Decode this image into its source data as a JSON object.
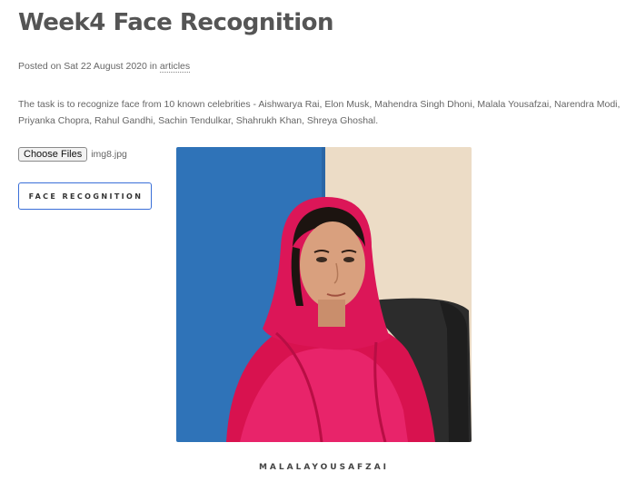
{
  "post": {
    "title": "Week4 Face Recognition",
    "meta_prefix": "Posted on Sat 22 August 2020 in ",
    "category": "articles",
    "description": "The task is to recognize face from 10 known celebrities - Aishwarya Rai, Elon Musk, Mahendra Singh Dhoni, Malala Yousafzai, Narendra Modi, Priyanka Chopra, Rahul Gandhi, Sachin Tendulkar, Shahrukh Khan, Shreya Ghoshal."
  },
  "upload": {
    "button_label": "Choose Files",
    "file_name": "img8.jpg"
  },
  "action": {
    "button_label": "FACE RECOGNITION"
  },
  "result": {
    "label": "MALALAYOUSAFZAI"
  },
  "colors": {
    "button_border": "#3a6fd8",
    "photo_wall_blue": "#2f73b8",
    "photo_wall_beige": "#ecdcc6",
    "scarf_pink": "#e0185c"
  }
}
